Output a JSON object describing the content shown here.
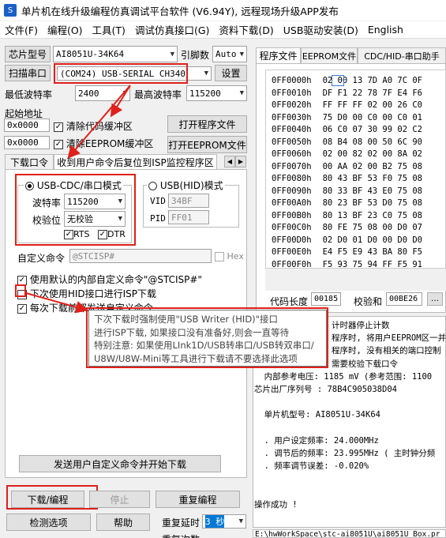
{
  "window": {
    "title": "单片机在线升级编程仿真调试平台软件 (V6.94Y), 远程现场升级APP发布"
  },
  "menu": [
    "文件(F)",
    "编程(O)",
    "工具(T)",
    "调试仿真接口(G)",
    "资料下载(D)",
    "USB驱动安装(D)",
    "English"
  ],
  "left": {
    "chip_label": "芯片型号",
    "chip_value": "AI8051U-34K64",
    "pin_label": "引脚数",
    "pin_value": "Auto",
    "scan_label": "扫描串口",
    "port_value": "(COM24) USB-SERIAL CH340",
    "settings": "设置",
    "min_baud_label": "最低波特率",
    "min_baud": "2400",
    "max_baud_label": "最高波特率",
    "max_baud": "115200",
    "start_addr_label": "起始地址",
    "addr1": "0x0000",
    "addr2": "0x0000",
    "clear_code": "清除代码缓冲区",
    "clear_eeprom": "清除EEPROM缓冲区",
    "open_prog": "打开程序文件",
    "open_eeprom": "打开EEPROM文件",
    "tab1": "下载口令",
    "tab2": "收到用户命令后复位到ISP监控程序区",
    "cdc_mode": "USB-CDC/串口模式",
    "hid_mode": "USB(HID)模式",
    "baud_label": "波特率",
    "baud_value": "115200",
    "parity_label": "校验位",
    "parity_value": "无校验",
    "rts": "RTS",
    "dtr": "DTR",
    "vid_label": "VID",
    "vid": "34BF",
    "pid_label": "PID",
    "pid": "FF01",
    "custom_label": "自定义命令",
    "custom_value": "@STCISP#",
    "hex_label": "Hex",
    "opt1": "使用默认的内部自定义命令\"@STCISP#\"",
    "opt2": "下次使用HID接口进行ISP下载",
    "opt3": "每次下载前都发送自定义命令",
    "send_btn": "发送用户自定义命令并开始下载",
    "download": "下载/编程",
    "stop": "停止",
    "reprogram": "重复编程",
    "check": "检测选项",
    "help": "帮助",
    "delay_label": "重复延时",
    "delay_value": "3 秒",
    "count_label": "重复次数"
  },
  "tooltip": [
    "下次下载时强制使用\"USB Writer (HID)\"接口",
    "进行ISP下载, 如果接口没有准备好,则会一直等待",
    "特别注意: 如果使用LInk1D/USB转串口/USB转双串口/",
    "U8W/U8W-Mini等工具进行下载请不要选择此选项"
  ],
  "right": {
    "tabs": [
      "程序文件",
      "EEPROM文件",
      "CDC/HID-串口助手"
    ],
    "hex": [
      [
        "0FF0000h",
        "02 00 13 7D A0 7C 0F"
      ],
      [
        "0FF0010h",
        "DF F1 22 78 7F E4 F6"
      ],
      [
        "0FF0020h",
        "FF FF FF 02 00 26 C0"
      ],
      [
        "0FF0030h",
        "75 D0 00 C0 00 C0 01"
      ],
      [
        "0FF0040h",
        "06 C0 07 30 99 02 C2"
      ],
      [
        "0FF0050h",
        "08 B4 08 00 50 6C 90"
      ],
      [
        "0FF0060h",
        "02 00 82 02 00 8A 02"
      ],
      [
        "0FF0070h",
        "00 AA 02 00 B2 75 08"
      ],
      [
        "0FF0080h",
        "80 43 BF 53 F0 75 08"
      ],
      [
        "0FF0090h",
        "80 33 BF 43 E0 75 08"
      ],
      [
        "0FF00A0h",
        "80 23 BF 53 D0 75 08"
      ],
      [
        "0FF00B0h",
        "80 13 BF 23 C0 75 08"
      ],
      [
        "0FF00C0h",
        "80 FE 75 08 00 D0 07"
      ],
      [
        "0FF00D0h",
        "02 D0 01 D0 00 D0 D0"
      ],
      [
        "0FF00E0h",
        "E4 F5 E9 43 BA 80 F5"
      ],
      [
        "0FF00F0h",
        "F5 93 75 94 FF F5 91"
      ]
    ],
    "code_len_label": "代码长度",
    "code_len": "00185",
    "checksum_label": "校验和",
    "checksum": "00BE26",
    "log": [
      "计时器停止计数",
      "程序时, 将用户EEPROM区一并",
      "程序时, 没有相关的端口控制",
      "需要校验下载口令",
      "  内部参考电压: 1185 mV (参考范围: 1100",
      "芯片出厂序列号 : 78B4C905038D04",
      "",
      "  单片机型号: AI8051U-34K64",
      "",
      "  . 用户设定频率: 24.000MHz",
      "  . 调节后的频率: 23.995MHz ( 主时钟分频",
      "  . 频率调节误差: -0.020%",
      "",
      "",
      "操作成功 !"
    ],
    "path": "E:\\hwWorkSpace\\stc-ai8051U\\ai8051U_Box.pr"
  }
}
